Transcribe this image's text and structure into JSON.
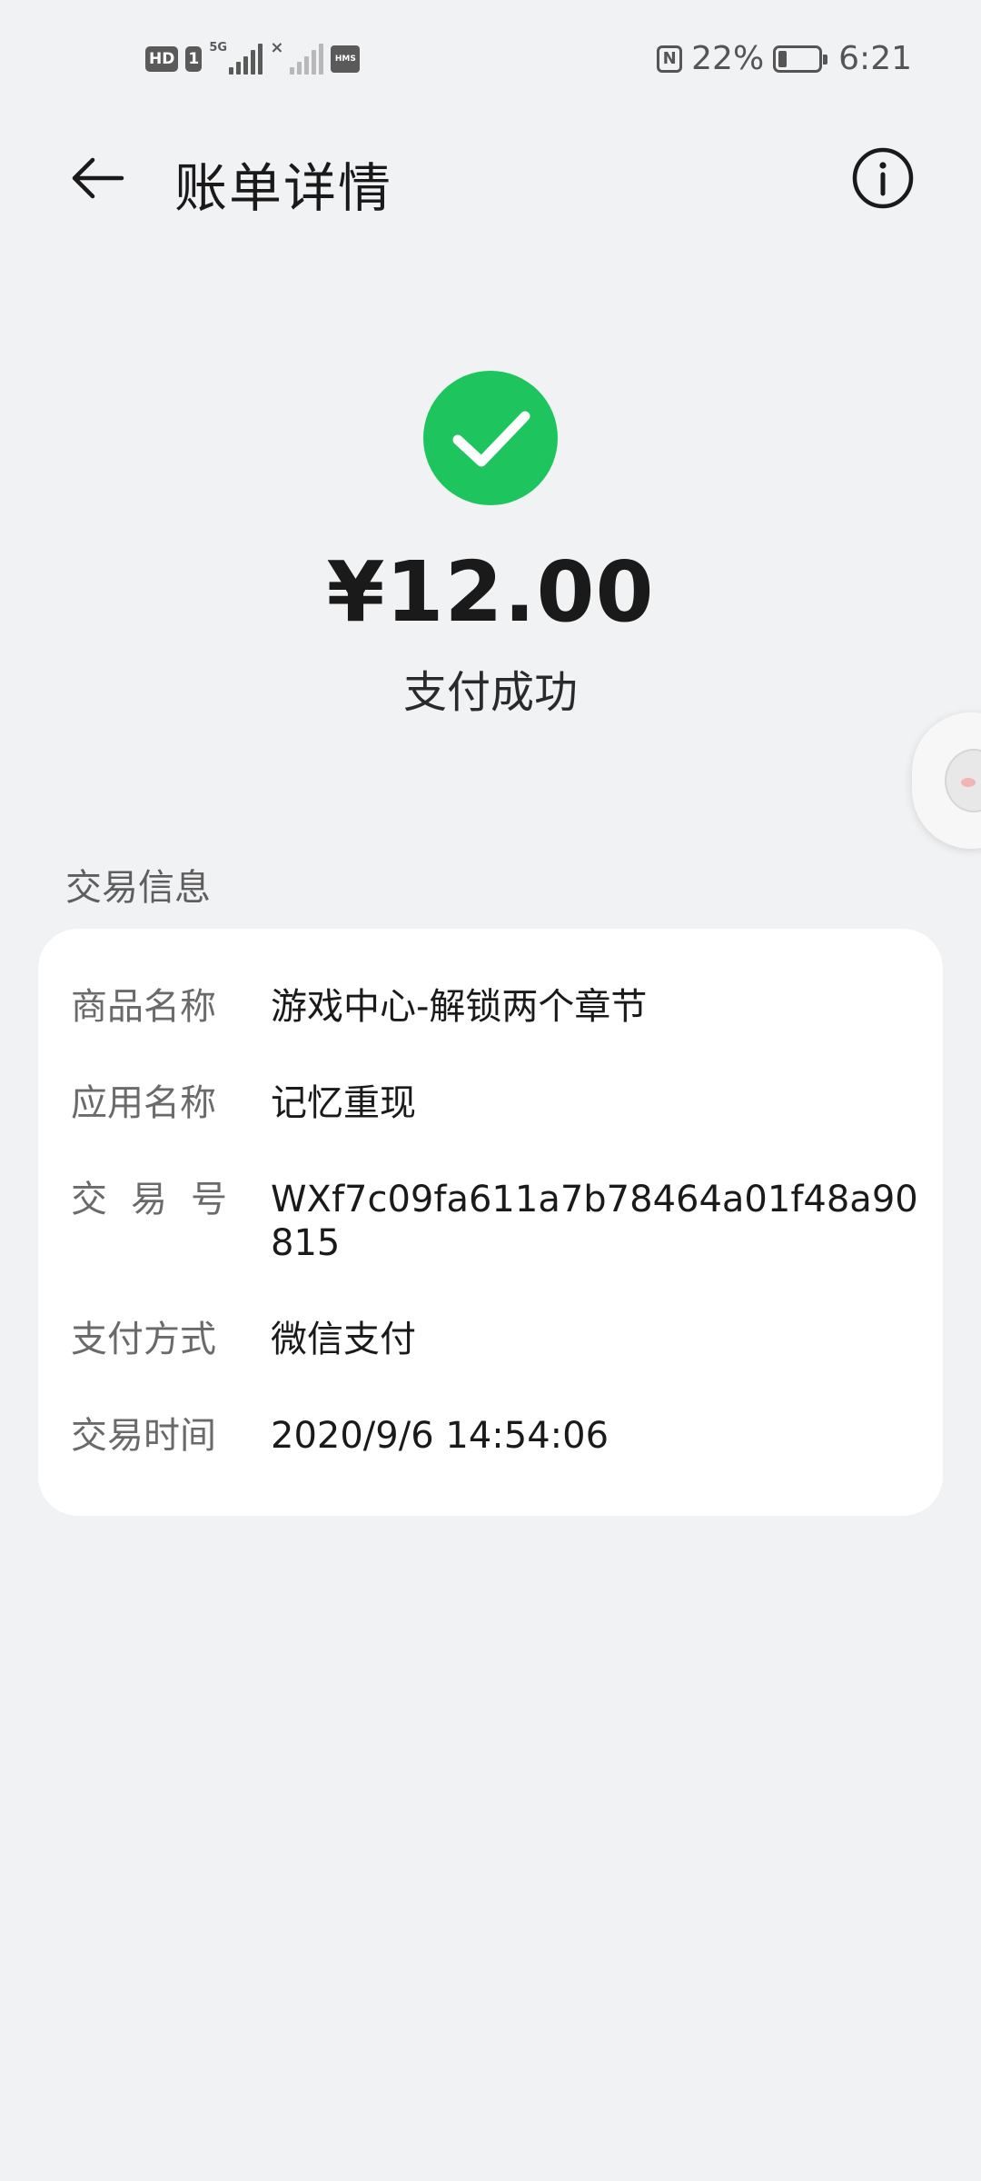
{
  "status_bar": {
    "hd_label": "HD",
    "sim_label": "1",
    "network_label": "5G",
    "hms_label": "HMS",
    "battery_percent": "22%",
    "battery_level": 0.22,
    "time": "6:21"
  },
  "header": {
    "title": "账单详情",
    "back_icon": "arrow-left-icon",
    "info_icon": "info-circle-icon"
  },
  "payment": {
    "amount": "¥12.00",
    "status": "支付成功",
    "status_icon": "check-circle-icon",
    "accent_color": "#1ec55e"
  },
  "transaction": {
    "section_title": "交易信息",
    "rows": [
      {
        "label": "商品名称",
        "value": "游戏中心-解锁两个章节"
      },
      {
        "label": "应用名称",
        "value": "记忆重现"
      },
      {
        "label": "交易号",
        "value": "WXf7c09fa611a7b78464a01f48a90815"
      },
      {
        "label": "支付方式",
        "value": "微信支付"
      },
      {
        "label": "交易时间",
        "value": "2020/9/6 14:54:06"
      }
    ]
  },
  "floating_assistant": {
    "icon": "assistant-avatar-icon"
  }
}
